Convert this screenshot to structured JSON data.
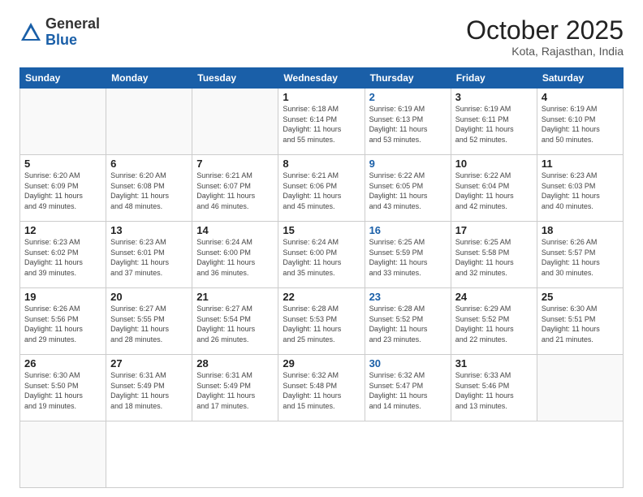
{
  "header": {
    "logo_general": "General",
    "logo_blue": "Blue",
    "month": "October 2025",
    "location": "Kota, Rajasthan, India"
  },
  "weekdays": [
    "Sunday",
    "Monday",
    "Tuesday",
    "Wednesday",
    "Thursday",
    "Friday",
    "Saturday"
  ],
  "days": [
    {
      "date": "",
      "info": ""
    },
    {
      "date": "",
      "info": ""
    },
    {
      "date": "",
      "info": ""
    },
    {
      "date": "1",
      "info": "Sunrise: 6:18 AM\nSunset: 6:14 PM\nDaylight: 11 hours\nand 55 minutes."
    },
    {
      "date": "2",
      "info": "Sunrise: 6:19 AM\nSunset: 6:13 PM\nDaylight: 11 hours\nand 53 minutes."
    },
    {
      "date": "3",
      "info": "Sunrise: 6:19 AM\nSunset: 6:11 PM\nDaylight: 11 hours\nand 52 minutes."
    },
    {
      "date": "4",
      "info": "Sunrise: 6:19 AM\nSunset: 6:10 PM\nDaylight: 11 hours\nand 50 minutes."
    },
    {
      "date": "5",
      "info": "Sunrise: 6:20 AM\nSunset: 6:09 PM\nDaylight: 11 hours\nand 49 minutes."
    },
    {
      "date": "6",
      "info": "Sunrise: 6:20 AM\nSunset: 6:08 PM\nDaylight: 11 hours\nand 48 minutes."
    },
    {
      "date": "7",
      "info": "Sunrise: 6:21 AM\nSunset: 6:07 PM\nDaylight: 11 hours\nand 46 minutes."
    },
    {
      "date": "8",
      "info": "Sunrise: 6:21 AM\nSunset: 6:06 PM\nDaylight: 11 hours\nand 45 minutes."
    },
    {
      "date": "9",
      "info": "Sunrise: 6:22 AM\nSunset: 6:05 PM\nDaylight: 11 hours\nand 43 minutes."
    },
    {
      "date": "10",
      "info": "Sunrise: 6:22 AM\nSunset: 6:04 PM\nDaylight: 11 hours\nand 42 minutes."
    },
    {
      "date": "11",
      "info": "Sunrise: 6:23 AM\nSunset: 6:03 PM\nDaylight: 11 hours\nand 40 minutes."
    },
    {
      "date": "12",
      "info": "Sunrise: 6:23 AM\nSunset: 6:02 PM\nDaylight: 11 hours\nand 39 minutes."
    },
    {
      "date": "13",
      "info": "Sunrise: 6:23 AM\nSunset: 6:01 PM\nDaylight: 11 hours\nand 37 minutes."
    },
    {
      "date": "14",
      "info": "Sunrise: 6:24 AM\nSunset: 6:00 PM\nDaylight: 11 hours\nand 36 minutes."
    },
    {
      "date": "15",
      "info": "Sunrise: 6:24 AM\nSunset: 6:00 PM\nDaylight: 11 hours\nand 35 minutes."
    },
    {
      "date": "16",
      "info": "Sunrise: 6:25 AM\nSunset: 5:59 PM\nDaylight: 11 hours\nand 33 minutes."
    },
    {
      "date": "17",
      "info": "Sunrise: 6:25 AM\nSunset: 5:58 PM\nDaylight: 11 hours\nand 32 minutes."
    },
    {
      "date": "18",
      "info": "Sunrise: 6:26 AM\nSunset: 5:57 PM\nDaylight: 11 hours\nand 30 minutes."
    },
    {
      "date": "19",
      "info": "Sunrise: 6:26 AM\nSunset: 5:56 PM\nDaylight: 11 hours\nand 29 minutes."
    },
    {
      "date": "20",
      "info": "Sunrise: 6:27 AM\nSunset: 5:55 PM\nDaylight: 11 hours\nand 28 minutes."
    },
    {
      "date": "21",
      "info": "Sunrise: 6:27 AM\nSunset: 5:54 PM\nDaylight: 11 hours\nand 26 minutes."
    },
    {
      "date": "22",
      "info": "Sunrise: 6:28 AM\nSunset: 5:53 PM\nDaylight: 11 hours\nand 25 minutes."
    },
    {
      "date": "23",
      "info": "Sunrise: 6:28 AM\nSunset: 5:52 PM\nDaylight: 11 hours\nand 23 minutes."
    },
    {
      "date": "24",
      "info": "Sunrise: 6:29 AM\nSunset: 5:52 PM\nDaylight: 11 hours\nand 22 minutes."
    },
    {
      "date": "25",
      "info": "Sunrise: 6:30 AM\nSunset: 5:51 PM\nDaylight: 11 hours\nand 21 minutes."
    },
    {
      "date": "26",
      "info": "Sunrise: 6:30 AM\nSunset: 5:50 PM\nDaylight: 11 hours\nand 19 minutes."
    },
    {
      "date": "27",
      "info": "Sunrise: 6:31 AM\nSunset: 5:49 PM\nDaylight: 11 hours\nand 18 minutes."
    },
    {
      "date": "28",
      "info": "Sunrise: 6:31 AM\nSunset: 5:49 PM\nDaylight: 11 hours\nand 17 minutes."
    },
    {
      "date": "29",
      "info": "Sunrise: 6:32 AM\nSunset: 5:48 PM\nDaylight: 11 hours\nand 15 minutes."
    },
    {
      "date": "30",
      "info": "Sunrise: 6:32 AM\nSunset: 5:47 PM\nDaylight: 11 hours\nand 14 minutes."
    },
    {
      "date": "31",
      "info": "Sunrise: 6:33 AM\nSunset: 5:46 PM\nDaylight: 11 hours\nand 13 minutes."
    },
    {
      "date": "",
      "info": ""
    },
    {
      "date": "",
      "info": ""
    }
  ]
}
